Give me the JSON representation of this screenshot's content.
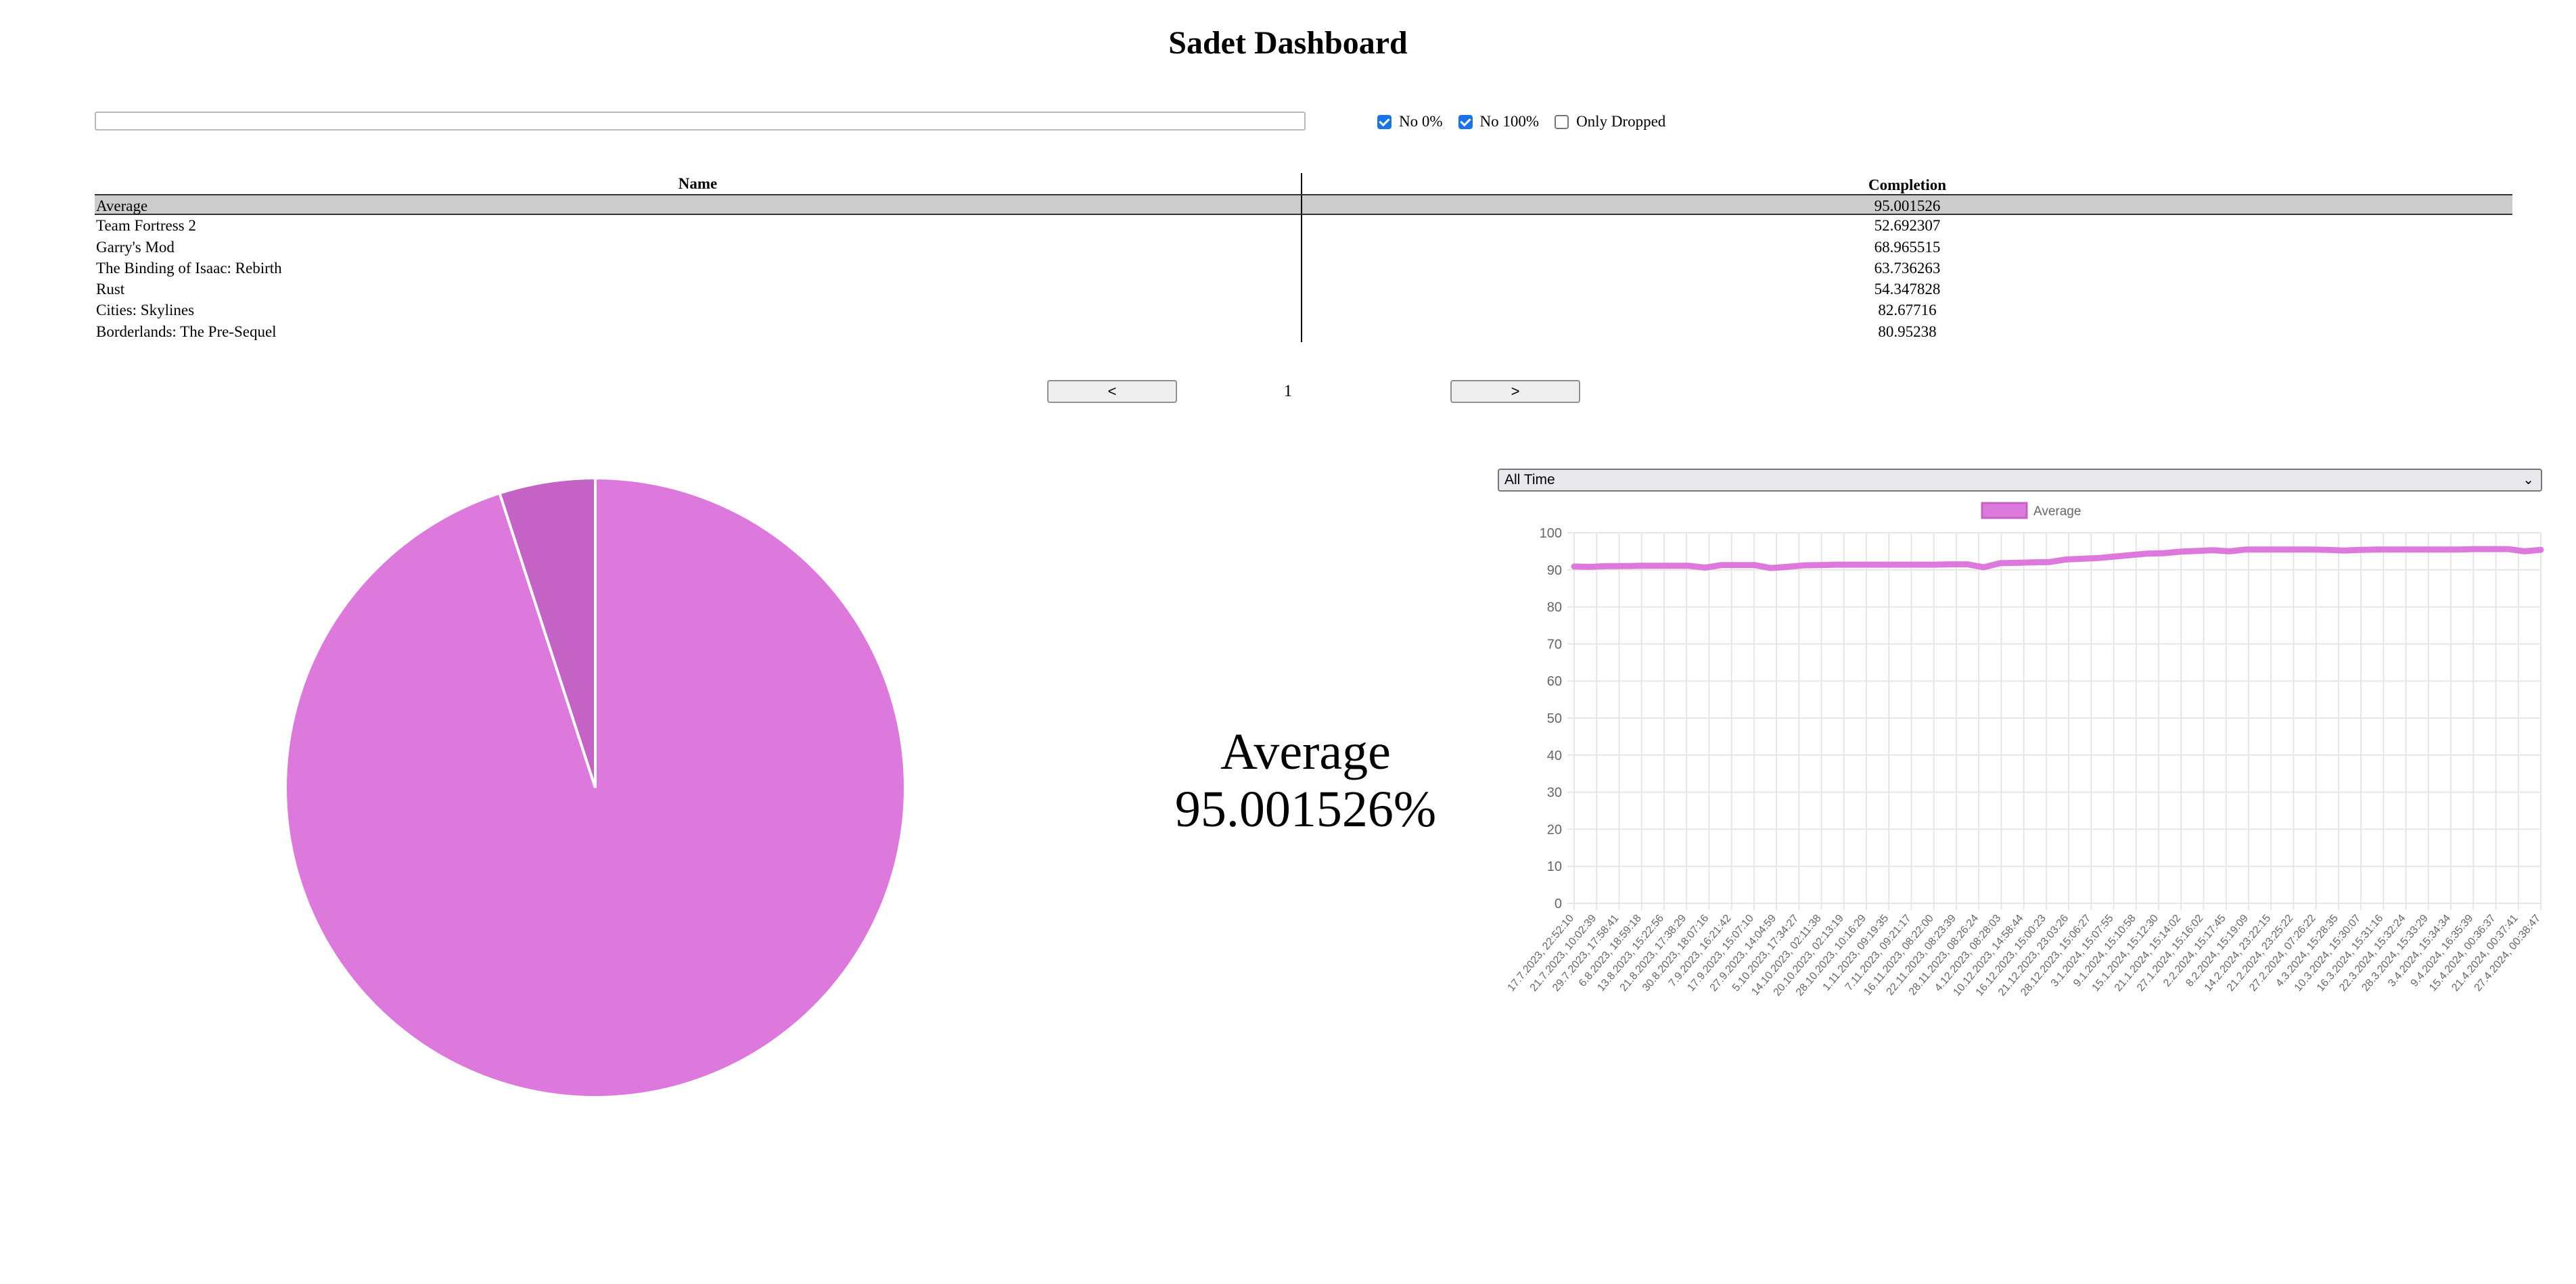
{
  "page": {
    "title": "Sadet Dashboard"
  },
  "search": {
    "value": "",
    "placeholder": ""
  },
  "filters": [
    {
      "label": "No 0%",
      "checked": true
    },
    {
      "label": "No 100%",
      "checked": true
    },
    {
      "label": "Only Dropped",
      "checked": false
    }
  ],
  "table": {
    "headers": {
      "name": "Name",
      "completion": "Completion"
    },
    "rows": [
      {
        "name": "Average",
        "completion": "95.001526",
        "selected": true
      },
      {
        "name": "Team Fortress 2",
        "completion": "52.692307"
      },
      {
        "name": "Garry's Mod",
        "completion": "68.965515"
      },
      {
        "name": "The Binding of Isaac: Rebirth",
        "completion": "63.736263"
      },
      {
        "name": "Rust",
        "completion": "54.347828"
      },
      {
        "name": "Cities: Skylines",
        "completion": "82.67716"
      },
      {
        "name": "Borderlands: The Pre-Sequel",
        "completion": "80.95238"
      }
    ]
  },
  "pager": {
    "prev_label": "<",
    "next_label": ">",
    "page": "1"
  },
  "average": {
    "label": "Average",
    "value_text": "95.001526%"
  },
  "time_range": {
    "selected": "All Time"
  },
  "colors": {
    "series": "#dd79dd",
    "pie_main": "#dd79dd",
    "pie_rest": "#c562c5",
    "checkbox": "#1a73e8"
  },
  "chart_data": [
    {
      "type": "pie",
      "values": [
        95.001526,
        4.998474
      ],
      "colors": [
        "#dd79dd",
        "#c562c5"
      ]
    },
    {
      "type": "line",
      "legend": "top",
      "grid": true,
      "ylim": [
        0,
        100
      ],
      "yticks": [
        0,
        10,
        20,
        30,
        40,
        50,
        60,
        70,
        80,
        90,
        100
      ],
      "xlabels": [
        "17.7.2023, 22:52:10",
        "21.7.2023, 10:02:39",
        "29.7.2023, 17:58:41",
        "6.8.2023, 18:59:18",
        "13.8.2023, 15:22:56",
        "21.8.2023, 17:38:29",
        "30.8.2023, 18:07:16",
        "7.9.2023, 16:21:42",
        "17.9.2023, 15:07:10",
        "27.9.2023, 14:04:59",
        "5.10.2023, 17:34:27",
        "14.10.2023, 02:11:38",
        "20.10.2023, 02:13:19",
        "28.10.2023, 10:16:29",
        "1.11.2023, 09:19:35",
        "7.11.2023, 09:21:17",
        "16.11.2023, 08:22:00",
        "22.11.2023, 08:23:39",
        "28.11.2023, 08:26:24",
        "4.12.2023, 08:28:03",
        "10.12.2023, 14:58:44",
        "16.12.2023, 15:00:23",
        "21.12.2023, 23:03:26",
        "28.12.2023, 15:06:27",
        "3.1.2024, 15:07:55",
        "9.1.2024, 15:10:58",
        "15.1.2024, 15:12:30",
        "21.1.2024, 15:14:02",
        "27.1.2024, 15:16:02",
        "2.2.2024, 15:17:45",
        "8.2.2024, 15:19:09",
        "14.2.2024, 23:22:15",
        "21.2.2024, 23:25:22",
        "27.2.2024, 07:26:22",
        "4.3.2024, 15:28:35",
        "10.3.2024, 15:30:07",
        "16.3.2024, 15:31:16",
        "22.3.2024, 15:32:24",
        "28.3.2024, 15:33:29",
        "3.4.2024, 15:34:34",
        "9.4.2024, 16:35:39",
        "15.4.2024, 00:36:37",
        "21.4.2024, 00:37:41",
        "27.4.2024, 00:38:47"
      ],
      "series": [
        {
          "name": "Average",
          "values": [
            90.9,
            90.8,
            91.0,
            91.0,
            91.1,
            91.1,
            91.1,
            91.1,
            90.6,
            91.3,
            91.3,
            91.3,
            90.5,
            90.8,
            91.2,
            91.3,
            91.4,
            91.4,
            91.4,
            91.4,
            91.4,
            91.4,
            91.4,
            91.5,
            91.5,
            90.7,
            91.8,
            91.9,
            92.0,
            92.1,
            92.8,
            93.0,
            93.2,
            93.6,
            94.0,
            94.4,
            94.5,
            94.9,
            95.1,
            95.3,
            95.0,
            95.5,
            95.5,
            95.5,
            95.5,
            95.5,
            95.4,
            95.2,
            95.4,
            95.5,
            95.5,
            95.5,
            95.5,
            95.5,
            95.5,
            95.6,
            95.6,
            95.6,
            95.0,
            95.4
          ]
        }
      ]
    }
  ]
}
